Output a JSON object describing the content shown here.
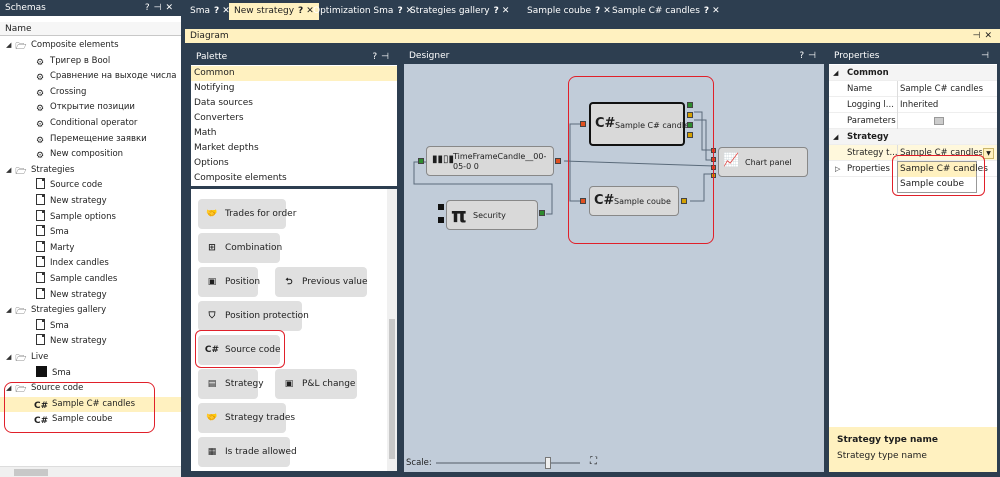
{
  "schemas": {
    "title": "Schemas",
    "column": "Name",
    "items": [
      {
        "label": "Composite elements",
        "level": 0,
        "icon": "folder-open-icon"
      },
      {
        "label": "Тригер в Bool",
        "level": 1,
        "icon": "element-icon"
      },
      {
        "label": "Сравнение на выходе числа",
        "level": 1,
        "icon": "element-icon"
      },
      {
        "label": "Crossing",
        "level": 1,
        "icon": "element-icon"
      },
      {
        "label": "Открытие позиции",
        "level": 1,
        "icon": "element-icon"
      },
      {
        "label": "Conditional operator",
        "level": 1,
        "icon": "element-icon"
      },
      {
        "label": "Перемещение заявки",
        "level": 1,
        "icon": "element-icon"
      },
      {
        "label": "New composition",
        "level": 1,
        "icon": "element-icon"
      },
      {
        "label": "Strategies",
        "level": 0,
        "icon": "folder-open-icon"
      },
      {
        "label": "Source code",
        "level": 1,
        "icon": "document-icon"
      },
      {
        "label": "New strategy",
        "level": 1,
        "icon": "document-icon"
      },
      {
        "label": "Sample options",
        "level": 1,
        "icon": "document-icon"
      },
      {
        "label": "Sma",
        "level": 1,
        "icon": "document-icon"
      },
      {
        "label": "Marty",
        "level": 1,
        "icon": "document-icon"
      },
      {
        "label": "Index candles",
        "level": 1,
        "icon": "document-icon"
      },
      {
        "label": "Sample candles",
        "level": 1,
        "icon": "document-icon"
      },
      {
        "label": "New strategy",
        "level": 1,
        "icon": "document-icon"
      },
      {
        "label": "Strategies gallery",
        "level": 0,
        "icon": "folder-open-icon"
      },
      {
        "label": "Sma",
        "level": 1,
        "icon": "document-icon"
      },
      {
        "label": "New strategy",
        "level": 1,
        "icon": "document-icon"
      },
      {
        "label": "Live",
        "level": 0,
        "icon": "folder-open-icon"
      },
      {
        "label": "Sma",
        "level": 1,
        "icon": "block-icon"
      },
      {
        "label": "Source code",
        "level": 0,
        "icon": "folder-open-icon"
      },
      {
        "label": "Sample C# candles",
        "level": 1,
        "icon": "csharp-icon",
        "selected": true
      },
      {
        "label": "Sample coube",
        "level": 1,
        "icon": "csharp-icon"
      }
    ]
  },
  "tabs": [
    {
      "label": "Sma",
      "active": false
    },
    {
      "label": "New strategy",
      "active": true
    },
    {
      "label": "Optimization Sma",
      "active": false
    },
    {
      "label": "Strategies gallery",
      "active": false
    },
    {
      "label": "Sample coube",
      "active": false
    },
    {
      "label": "Sample C# candles",
      "active": false
    }
  ],
  "diagram": {
    "title": "Diagram"
  },
  "palette": {
    "title": "Palette",
    "categories": [
      "Common",
      "Notifying",
      "Data sources",
      "Converters",
      "Math",
      "Market depths",
      "Options",
      "Composite elements"
    ],
    "selected_category": "Common",
    "buttons": [
      {
        "label": "Trades for order",
        "icon": "handshake-icon"
      },
      {
        "label": "Combination",
        "icon": "combination-icon"
      },
      {
        "label": "Position",
        "icon": "position-icon"
      },
      {
        "label": "Previous value",
        "icon": "previous-arrow-icon"
      },
      {
        "label": "Position protection",
        "icon": "shield-icon"
      },
      {
        "label": "Source code",
        "icon": "csharp-icon"
      },
      {
        "label": "Strategy",
        "icon": "strategy-icon"
      },
      {
        "label": "P&L change",
        "icon": "pnl-icon"
      },
      {
        "label": "Strategy trades",
        "icon": "handshake-icon"
      },
      {
        "label": "Is trade allowed",
        "icon": "calendar-clock-icon"
      }
    ]
  },
  "designer": {
    "title": "Designer",
    "scale_label": "Scale:",
    "scale_value": 0.5,
    "nodes": {
      "timeframe": "TimeFrameCandle__00-05-0 0",
      "security": "Security",
      "sample_candles": "Sample C# candles",
      "sample_coube": "Sample coube",
      "chart": "Chart panel"
    }
  },
  "properties": {
    "title": "Properties",
    "sections": [
      "Common",
      "Strategy"
    ],
    "rows": [
      {
        "key": "Name",
        "value": "Sample C# candles"
      },
      {
        "key": "Logging l...",
        "value": "Inherited"
      },
      {
        "key": "Parameters",
        "value": ""
      },
      {
        "key": "Strategy t...",
        "value": "Sample C# candles"
      },
      {
        "key": "Properties",
        "value": ""
      }
    ],
    "dropdown_options": [
      "Sample C# candles",
      "Sample coube"
    ],
    "description_title": "Strategy type name",
    "description_text": "Strategy type name"
  },
  "colors": {
    "accent": "#fff1c0",
    "frame": "#2d3e50",
    "highlight": "#e0202a",
    "designer_bg": "#c1ccd9"
  }
}
